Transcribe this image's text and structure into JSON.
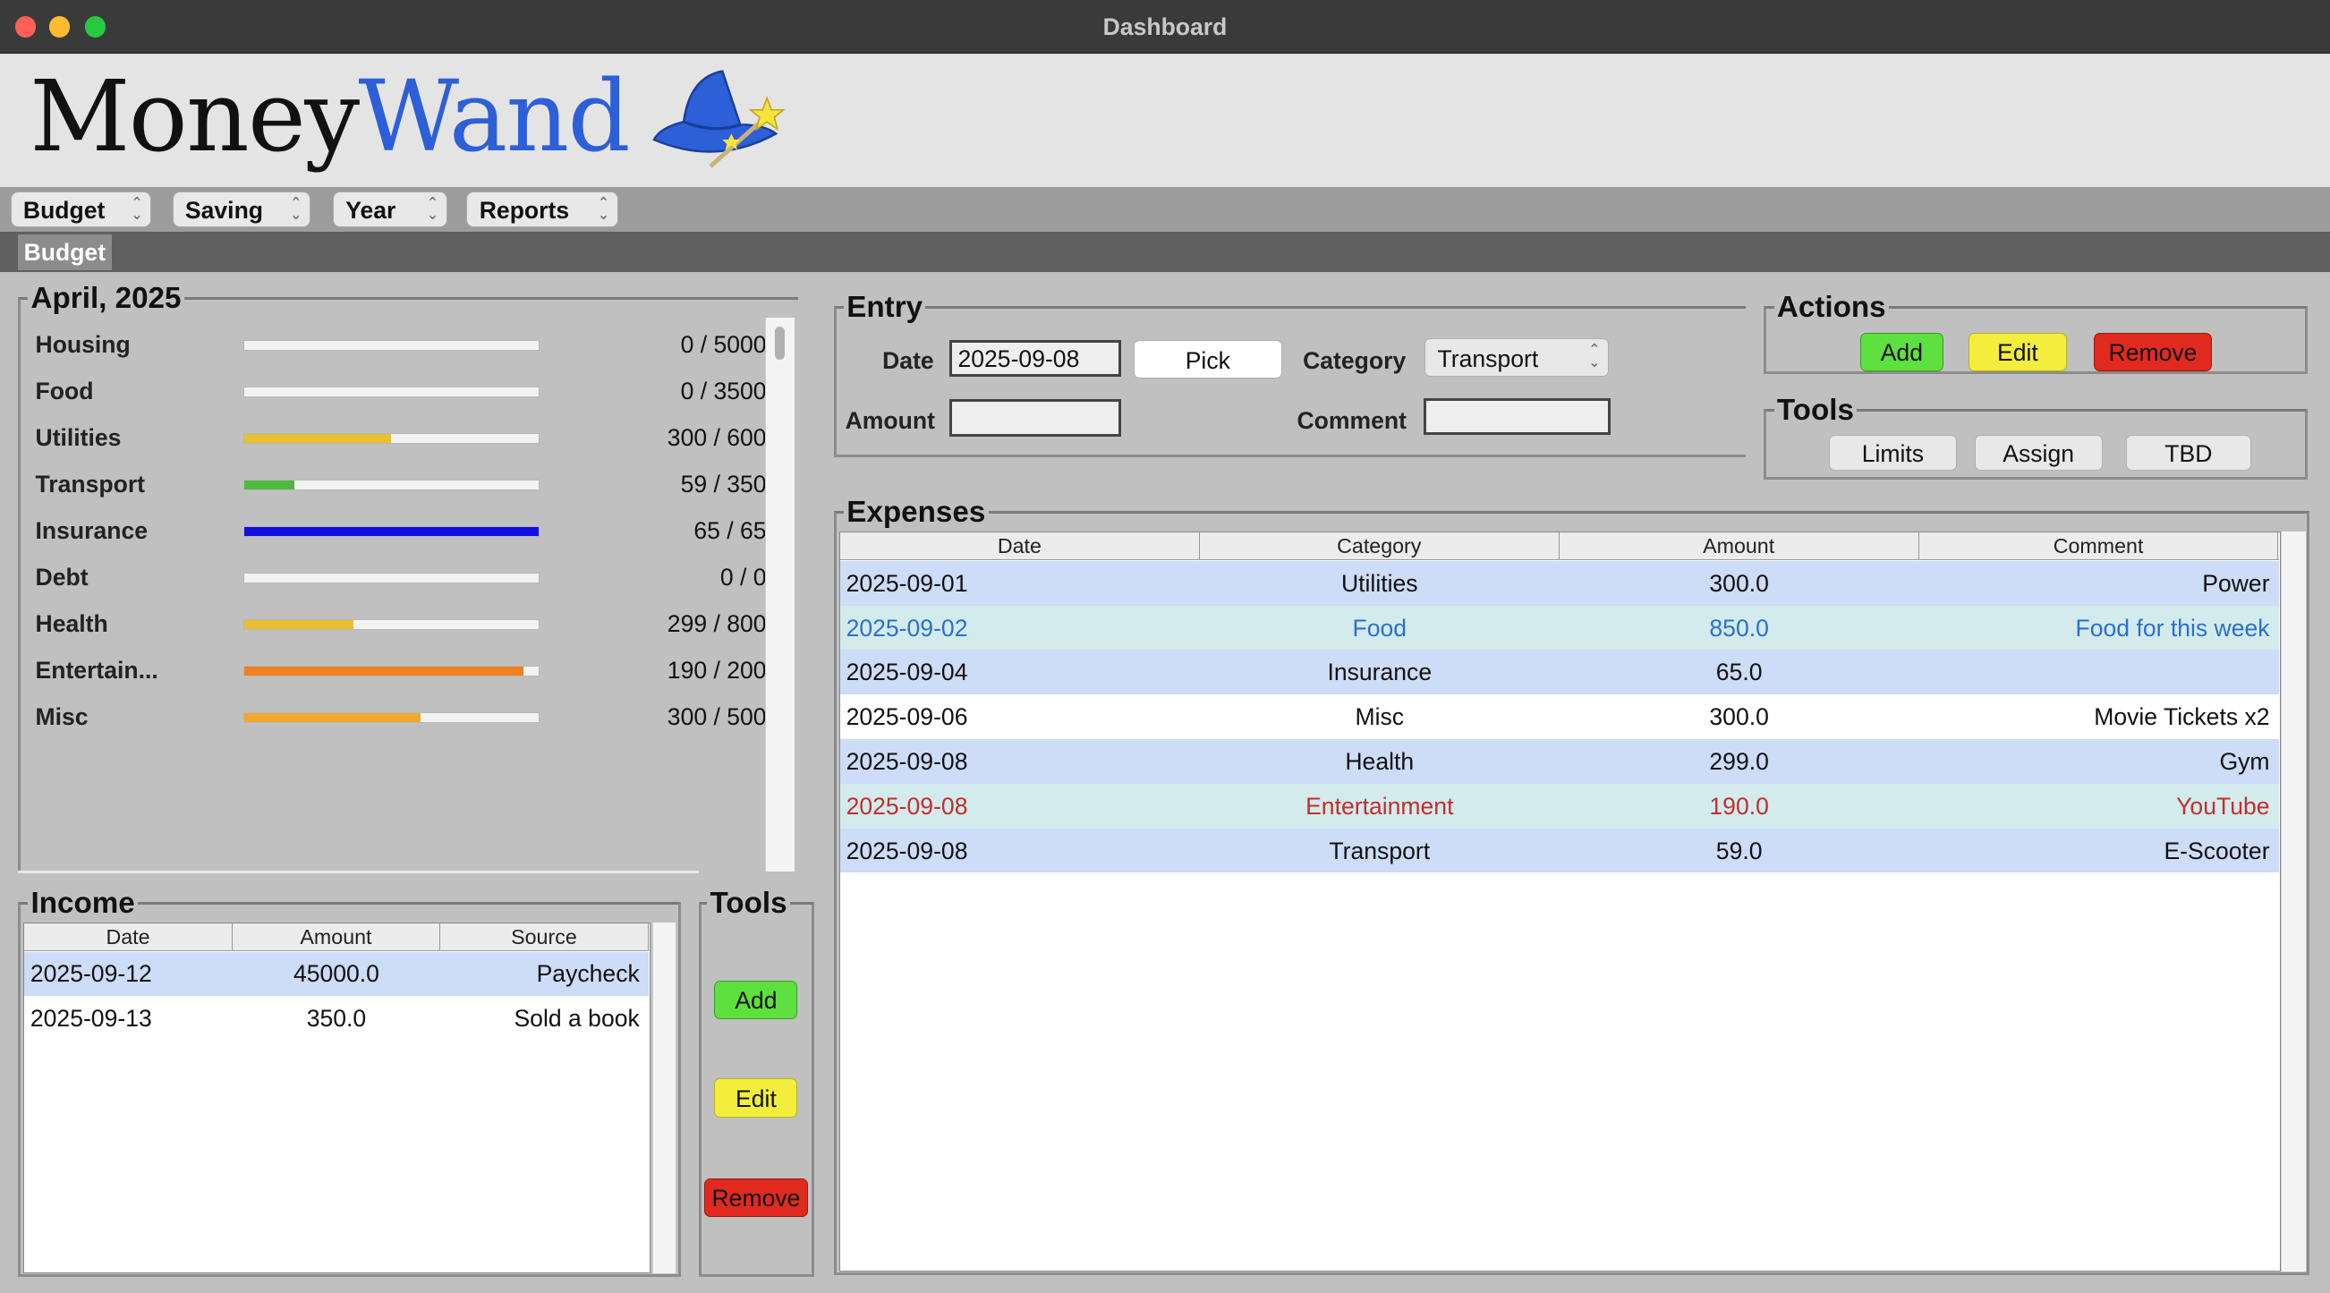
{
  "window": {
    "title": "Dashboard"
  },
  "logo": {
    "part1": "Money",
    "part2": "Wand",
    "icon": "wizard-hat-icon"
  },
  "menus": [
    {
      "label": "Budget"
    },
    {
      "label": "Saving"
    },
    {
      "label": "Year"
    },
    {
      "label": "Reports"
    }
  ],
  "tab": {
    "label": "Budget"
  },
  "budget": {
    "title": "April, 2025",
    "rows": [
      {
        "name": "Housing",
        "value": "0 / 5000",
        "progress": 0,
        "color": "#f2f2f2"
      },
      {
        "name": "Food",
        "value": "0 / 3500",
        "progress": 0,
        "color": "#f2f2f2"
      },
      {
        "name": "Utilities",
        "value": "300 / 600",
        "progress": 0.5,
        "color": "#e8c030"
      },
      {
        "name": "Transport",
        "value": "59 / 350",
        "progress": 0.17,
        "color": "#50b840"
      },
      {
        "name": "Insurance",
        "value": "65 / 65",
        "progress": 1.0,
        "color": "#1010e0"
      },
      {
        "name": "Debt",
        "value": "0 / 0",
        "progress": 0,
        "color": "#f2f2f2"
      },
      {
        "name": "Health",
        "value": "299 / 800",
        "progress": 0.37,
        "color": "#e8c030"
      },
      {
        "name": "Entertain...",
        "value": "190 / 200",
        "progress": 0.95,
        "color": "#f08020"
      },
      {
        "name": "Misc",
        "value": "300 / 500",
        "progress": 0.6,
        "color": "#f0a830"
      }
    ]
  },
  "income": {
    "title": "Income",
    "headers": [
      "Date",
      "Amount",
      "Source"
    ],
    "rows": [
      {
        "date": "2025-09-12",
        "amount": "45000.0",
        "source": "Paycheck"
      },
      {
        "date": "2025-09-13",
        "amount": "350.0",
        "source": "Sold a book"
      }
    ]
  },
  "income_tools": {
    "title": "Tools",
    "add": "Add",
    "edit": "Edit",
    "remove": "Remove"
  },
  "entry": {
    "title": "Entry",
    "date_label": "Date",
    "date_value": "2025-09-08",
    "pick_label": "Pick",
    "category_label": "Category",
    "category_value": "Transport",
    "amount_label": "Amount",
    "amount_value": "",
    "comment_label": "Comment",
    "comment_value": ""
  },
  "actions": {
    "title": "Actions",
    "add": "Add",
    "edit": "Edit",
    "remove": "Remove"
  },
  "tools": {
    "title": "Tools",
    "limits": "Limits",
    "assign": "Assign",
    "tbd": "TBD"
  },
  "expenses": {
    "title": "Expenses",
    "headers": [
      "Date",
      "Category",
      "Amount",
      "Comment"
    ],
    "rows": [
      {
        "date": "2025-09-01",
        "category": "Utilities",
        "amount": "300.0",
        "comment": "Power",
        "bg": "#cddcf7",
        "color": "#111111"
      },
      {
        "date": "2025-09-02",
        "category": "Food",
        "amount": "850.0",
        "comment": "Food for this week",
        "bg": "#d4ebee",
        "color": "#2a6fd0"
      },
      {
        "date": "2025-09-04",
        "category": "Insurance",
        "amount": "65.0",
        "comment": "",
        "bg": "#cddcf7",
        "color": "#111111"
      },
      {
        "date": "2025-09-06",
        "category": "Misc",
        "amount": "300.0",
        "comment": "Movie Tickets x2",
        "bg": "#ffffff",
        "color": "#111111"
      },
      {
        "date": "2025-09-08",
        "category": "Health",
        "amount": "299.0",
        "comment": "Gym",
        "bg": "#cddcf7",
        "color": "#111111"
      },
      {
        "date": "2025-09-08",
        "category": "Entertainment",
        "amount": "190.0",
        "comment": "YouTube",
        "bg": "#d4ebee",
        "color": "#c0302a"
      },
      {
        "date": "2025-09-08",
        "category": "Transport",
        "amount": "59.0",
        "comment": "E-Scooter",
        "bg": "#cddcf7",
        "color": "#111111"
      }
    ]
  }
}
